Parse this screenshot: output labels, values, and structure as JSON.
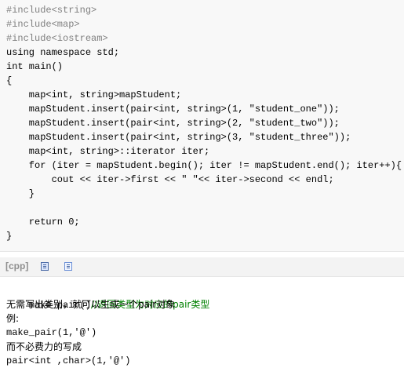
{
  "code": {
    "lines": [
      "#include<string>",
      "#include<map>",
      "#include<iostream>",
      "using namespace std;",
      "int main()",
      "{",
      "    map<int, string>mapStudent;",
      "    mapStudent.insert(pair<int, string>(1, \"student_one\"));",
      "    mapStudent.insert(pair<int, string>(2, \"student_two\"));",
      "    mapStudent.insert(pair<int, string>(3, \"student_three\"));",
      "    map<int, string>::iterator iter;",
      "    for (iter = mapStudent.begin(); iter != mapStudent.end(); iter++){",
      "        cout << iter->first << \" \"<< iter->second << endl;",
      "    }",
      "",
      "    return 0;",
      "}"
    ]
  },
  "toolbar": {
    "language_label": "[cpp]",
    "icons": [
      "view-plain-icon",
      "copy-icon"
    ]
  },
  "notes": {
    "line1_code": "make_pair()",
    "line1_comment": "//返回类型为对应的pair类型",
    "line2": "无需写出类别，就可以生成一个pair对象",
    "line3": "例:",
    "line4": "make_pair(1,'@')",
    "line5": "而不必费力的写成",
    "line6": "pair<int ,char>(1,'@')"
  }
}
